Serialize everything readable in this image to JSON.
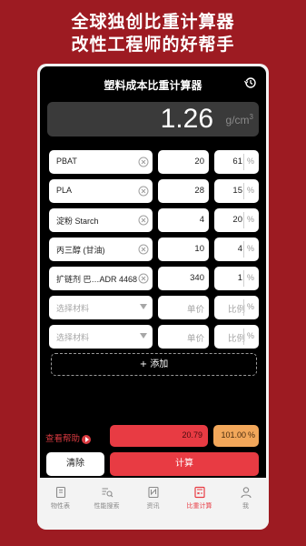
{
  "promo": {
    "line1": "全球独创比重计算器",
    "line2": "改性工程师的好帮手"
  },
  "header": {
    "title": "塑料成本比重计算器",
    "history_icon": "history-icon"
  },
  "result": {
    "value": "1.26",
    "unit": "g/cm",
    "unit_sup": "3"
  },
  "materials": [
    {
      "name": "PBAT",
      "price": "20",
      "ratio": "61",
      "pct": "%"
    },
    {
      "name": "PLA",
      "price": "28",
      "ratio": "15",
      "pct": "%"
    },
    {
      "name": "淀粉 Starch",
      "price": "4",
      "ratio": "20",
      "pct": "%"
    },
    {
      "name": "丙三醇 (甘油)",
      "price": "10",
      "ratio": "4",
      "pct": "%"
    },
    {
      "name": "扩链剂 巴…ADR 4468",
      "price": "340",
      "ratio": "1",
      "pct": "%"
    }
  ],
  "empty_rows": [
    {
      "placeholder": "选择材料",
      "price_placeholder": "单价",
      "ratio_placeholder": "比例",
      "pct": "%"
    },
    {
      "placeholder": "选择材料",
      "price_placeholder": "单价",
      "ratio_placeholder": "比例",
      "pct": "%"
    }
  ],
  "actions": {
    "add_label": "+ 添加",
    "help_label": "查看帮助",
    "total_price": "20.79",
    "total_ratio": "101.00",
    "total_pct": "%",
    "clear_label": "清除",
    "calc_label": "计算"
  },
  "tabs": [
    {
      "label": "物性表",
      "icon": "book-icon",
      "active": false
    },
    {
      "label": "性能搜索",
      "icon": "search-list-icon",
      "active": false
    },
    {
      "label": "资讯",
      "icon": "news-icon",
      "active": false
    },
    {
      "label": "比重计算",
      "icon": "calculator-icon",
      "active": true
    },
    {
      "label": "我",
      "icon": "user-icon",
      "active": false
    }
  ],
  "colors": {
    "background": "#9d1b22",
    "accent": "#e83b43",
    "ratio_total": "#f2a75a"
  }
}
